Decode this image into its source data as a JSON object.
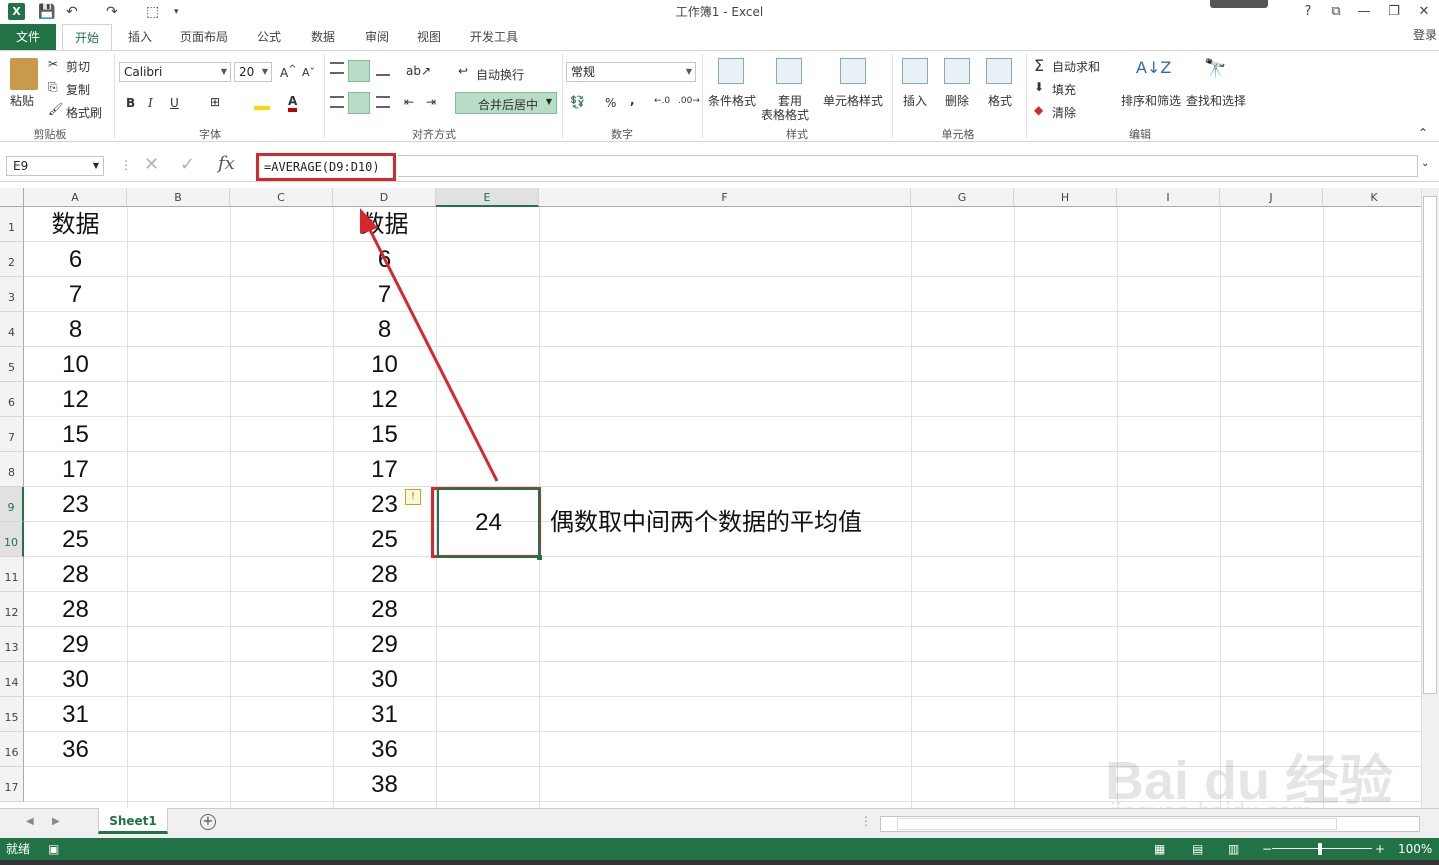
{
  "window": {
    "title": "工作簿1 - Excel",
    "help": "?",
    "signin": "登录"
  },
  "app_logo": "X",
  "tabs": [
    {
      "label": "文件"
    },
    {
      "label": "开始"
    },
    {
      "label": "插入"
    },
    {
      "label": "页面布局"
    },
    {
      "label": "公式"
    },
    {
      "label": "数据"
    },
    {
      "label": "审阅"
    },
    {
      "label": "视图"
    },
    {
      "label": "开发工具"
    }
  ],
  "ribbon": {
    "clipboard": {
      "paste": "粘贴",
      "cut": "剪切",
      "copy": "复制",
      "format_painter": "格式刷",
      "label": "剪贴板"
    },
    "font": {
      "name": "Calibri",
      "size": "20",
      "bold": "B",
      "italic": "I",
      "underline": "U",
      "label": "字体"
    },
    "alignment": {
      "wrap": "自动换行",
      "merge": "合并后居中",
      "label": "对齐方式"
    },
    "number": {
      "format": "常规",
      "percent": "%",
      "comma": ",",
      "label": "数字"
    },
    "styles": {
      "conditional": "条件格式",
      "table_line1": "套用",
      "table_line2": "表格格式",
      "cell_styles": "单元格样式",
      "label": "样式"
    },
    "cells": {
      "insert": "插入",
      "delete": "删除",
      "format": "格式",
      "label": "单元格"
    },
    "editing": {
      "autosum": "自动求和",
      "fill": "填充",
      "clear": "清除",
      "sort": "排序和筛选",
      "find": "查找和选择",
      "label": "编辑"
    }
  },
  "formula_bar": {
    "name_box": "E9",
    "fx": "fx",
    "formula": "=AVERAGE(D9:D10)"
  },
  "columns": [
    "A",
    "B",
    "C",
    "D",
    "E",
    "F",
    "G",
    "H",
    "I",
    "J",
    "K"
  ],
  "rows": [
    "1",
    "2",
    "3",
    "4",
    "5",
    "6",
    "7",
    "8",
    "9",
    "10",
    "11",
    "12",
    "13",
    "14",
    "15",
    "16",
    "17"
  ],
  "col_a": [
    "数据",
    "6",
    "7",
    "8",
    "10",
    "12",
    "15",
    "17",
    "23",
    "25",
    "28",
    "28",
    "29",
    "30",
    "31",
    "36",
    ""
  ],
  "col_d": [
    "数据",
    "6",
    "7",
    "8",
    "10",
    "12",
    "15",
    "17",
    "23",
    "25",
    "28",
    "28",
    "29",
    "30",
    "31",
    "36",
    "38"
  ],
  "result": {
    "value": "24",
    "annotation": "偶数取中间两个数据的平均值"
  },
  "sheet": {
    "tab": "Sheet1",
    "add": "+"
  },
  "status": {
    "ready": "就绪",
    "zoom": "100%"
  },
  "watermark": {
    "brand": "Bai du 经验",
    "url": "jingyan.baidu.com"
  },
  "colors": {
    "excel_green": "#217346",
    "highlight_red": "#d9262c"
  }
}
